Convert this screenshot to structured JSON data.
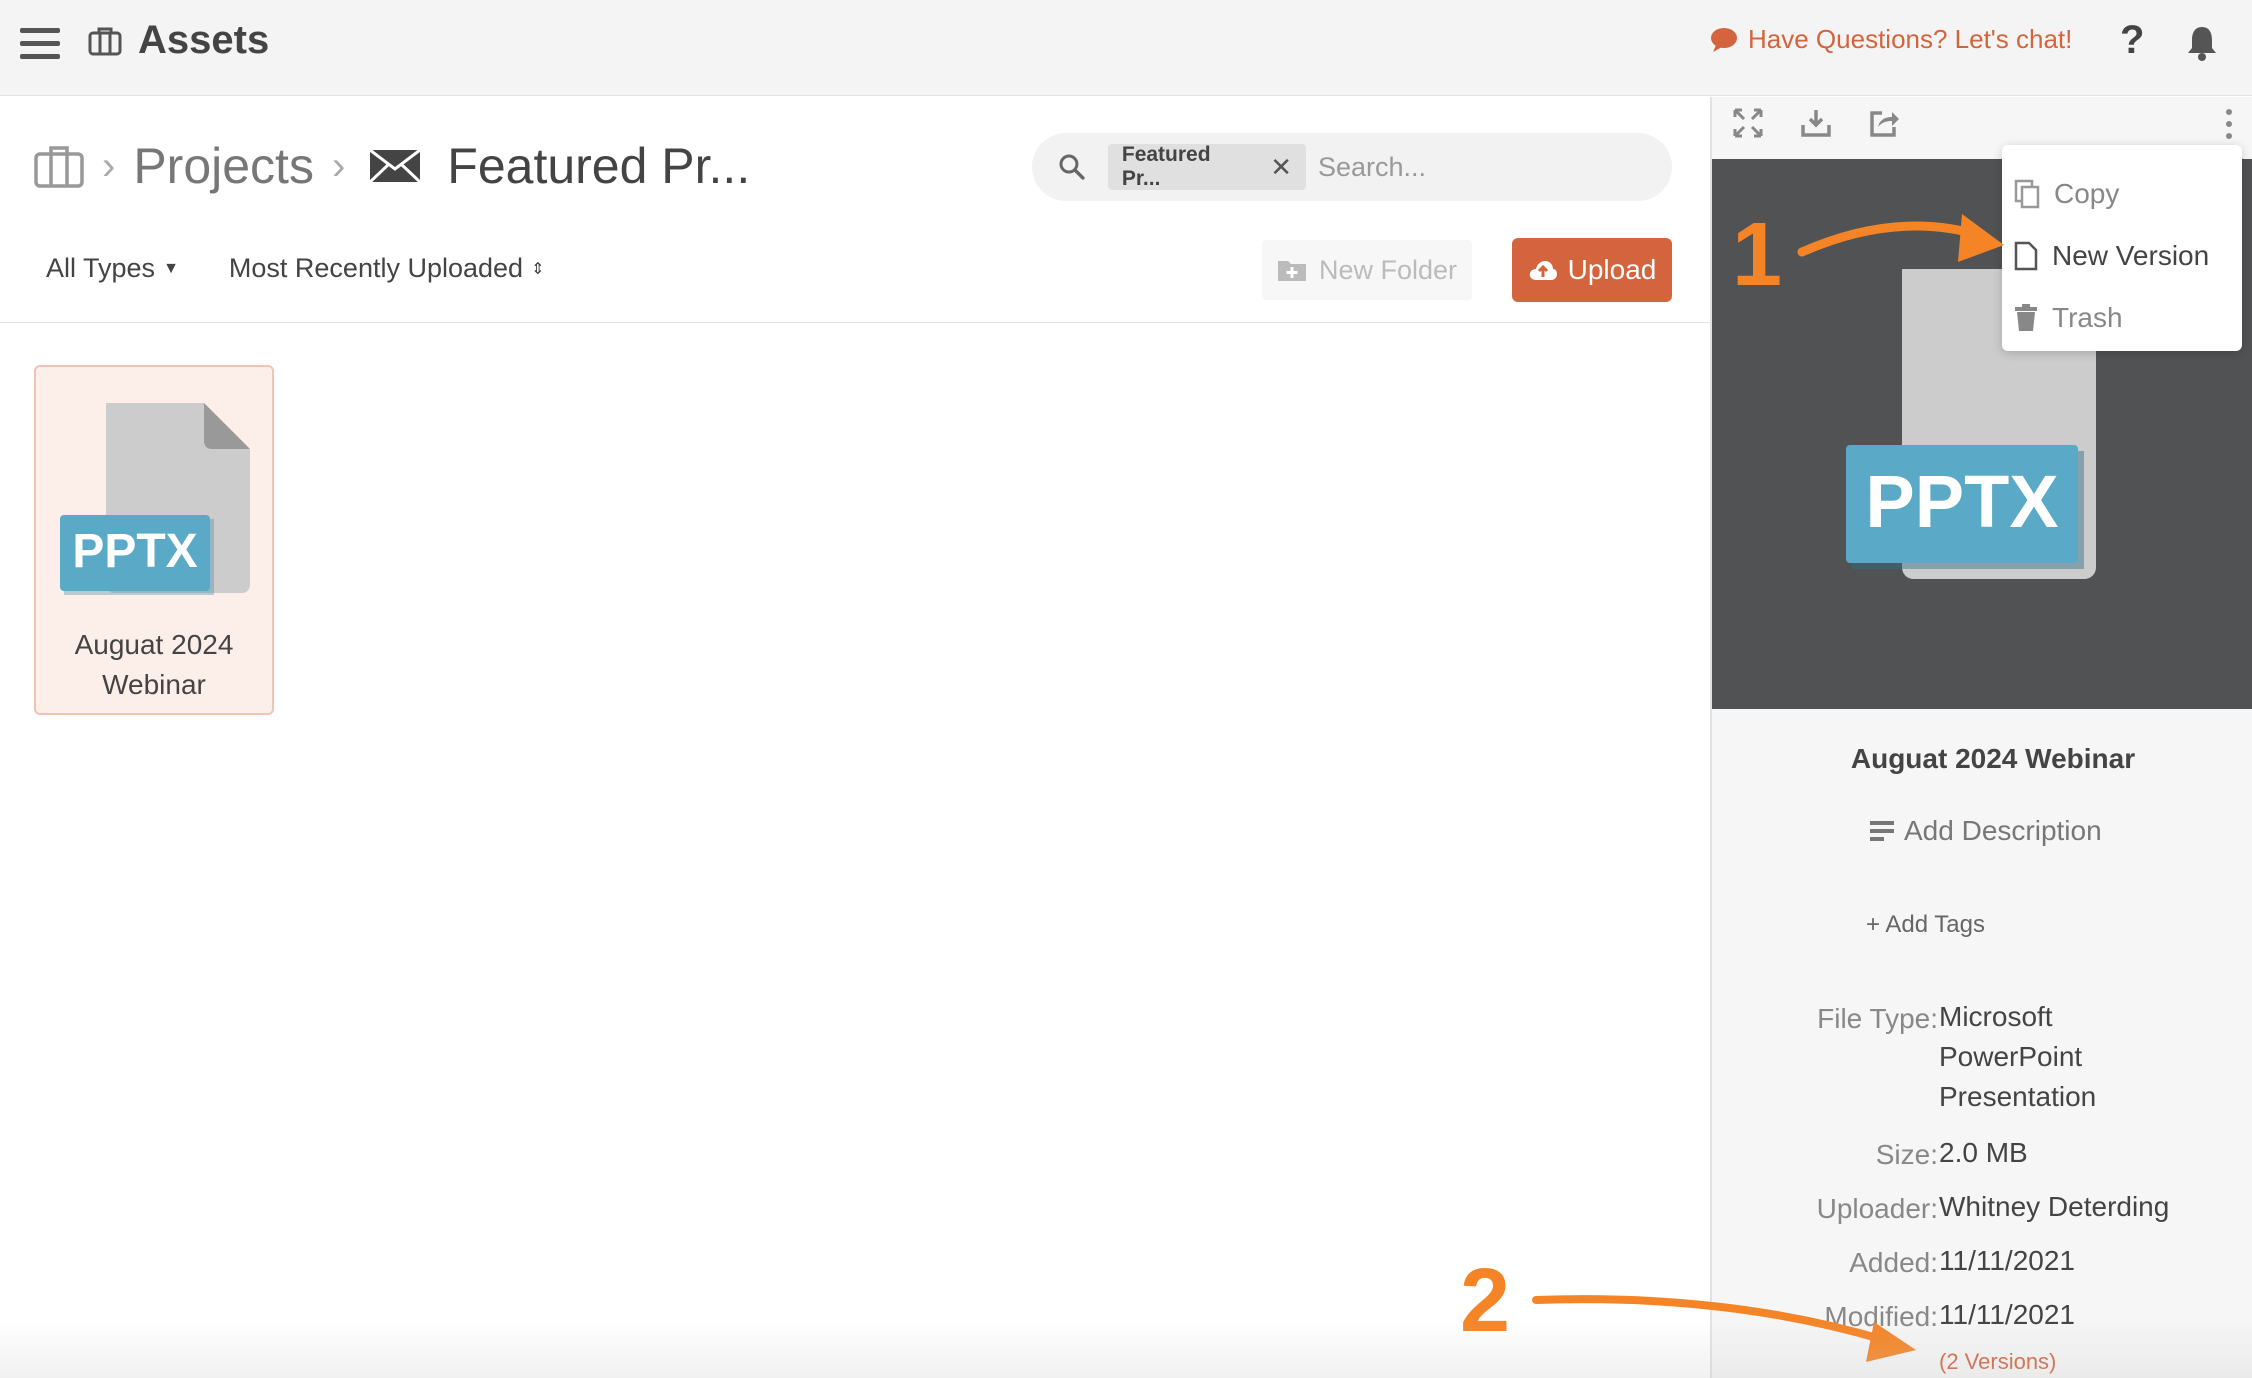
{
  "topbar": {
    "title": "Assets",
    "chat_label": "Have Questions? Let's chat!",
    "help_label": "?"
  },
  "breadcrumb": {
    "projects": "Projects",
    "current": "Featured Pr..."
  },
  "search": {
    "chip": "Featured Pr...",
    "placeholder": "Search..."
  },
  "filters": {
    "type": "All Types",
    "sort": "Most Recently Uploaded"
  },
  "actions": {
    "new_folder": "New Folder",
    "upload": "Upload"
  },
  "files": [
    {
      "badge": "PPTX",
      "name_line1": "Auguat 2024",
      "name_line2": "Webinar"
    }
  ],
  "context_menu": {
    "copy": "Copy",
    "new_version": "New Version",
    "trash": "Trash"
  },
  "details": {
    "preview_badge": "PPTX",
    "name": "Auguat 2024 Webinar",
    "add_description": "Add Description",
    "add_tags": "+ Add Tags",
    "file_type_label": "File Type:",
    "file_type_line1": "Microsoft",
    "file_type_line2": "PowerPoint",
    "file_type_line3": "Presentation",
    "size_label": "Size:",
    "size": "2.0 MB",
    "uploader_label": "Uploader:",
    "uploader": "Whitney Deterding",
    "added_label": "Added:",
    "added": "11/11/2021",
    "modified_label": "Modified:",
    "modified": "11/11/2021",
    "versions": "(2 Versions)"
  },
  "annotations": {
    "step1": "1",
    "step2": "2"
  },
  "colors": {
    "accent": "#d4643e",
    "annotation": "#f58426",
    "pptx_badge": "#5aa9c6",
    "preview_bg": "#505254"
  }
}
